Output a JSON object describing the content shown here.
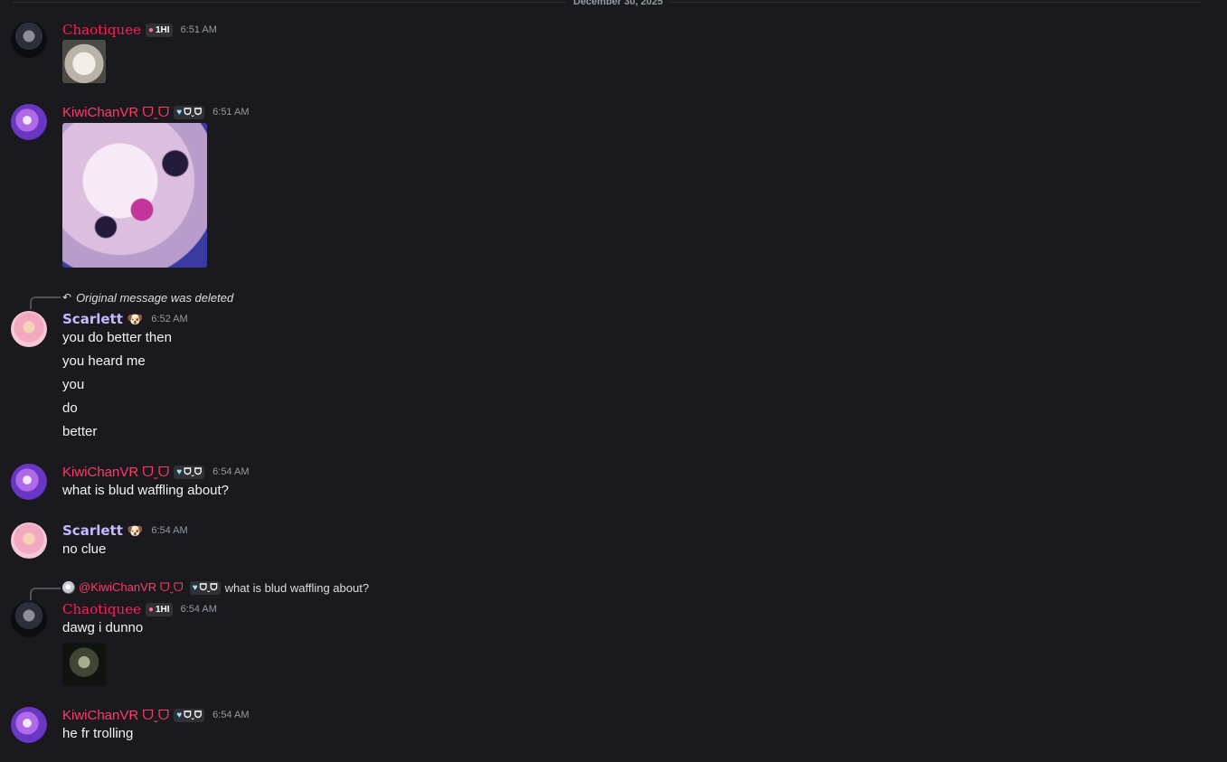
{
  "date_divider": "December 30, 2025",
  "messages": [
    {
      "author": "Chaotiquee",
      "tag": "1HI",
      "time": "6:51 AM",
      "image": "dog-photo"
    },
    {
      "author": "KiwiChanVR ᗜˬᗜ",
      "tag": "ᗜˬᗜ",
      "time": "6:51 AM",
      "image": "pink-character-art"
    },
    {
      "reply": "Original message was deleted",
      "author": "Scarlett",
      "emoji": "🐶",
      "time": "6:52 AM",
      "lines": [
        "you do better then",
        "you heard me",
        "you",
        "do",
        "better"
      ]
    },
    {
      "author": "KiwiChanVR ᗜˬᗜ",
      "tag": "ᗜˬᗜ",
      "time": "6:54 AM",
      "lines": [
        "what is blud waffling about?"
      ]
    },
    {
      "author": "Scarlett",
      "emoji": "🐶",
      "time": "6:54 AM",
      "lines": [
        "no clue"
      ]
    },
    {
      "reply_to": {
        "name": "@KiwiChanVR ᗜˬᗜ",
        "tag": "ᗜˬᗜ",
        "text": "what is blud waffling about?"
      },
      "author": "Chaotiquee",
      "tag": "1HI",
      "time": "6:54 AM",
      "lines": [
        "dawg i dunno"
      ],
      "image": "dark-ghost-photo"
    },
    {
      "author": "KiwiChanVR ᗜˬᗜ",
      "tag": "ᗜˬᗜ",
      "time": "6:54 AM",
      "lines": [
        "he fr trolling"
      ]
    }
  ],
  "colors": {
    "background": "#1a1a1e",
    "chaotiquee_name": "#ff1e5a",
    "kiwi_name": "#ff3b6b",
    "scarlett_name": "#c7b9ff",
    "timestamp": "#949ba4"
  },
  "icons": {
    "chaos_tag_glyph": "skull",
    "kiwi_tag_glyph": "heart",
    "reply_glyph": "reply-arrow"
  }
}
